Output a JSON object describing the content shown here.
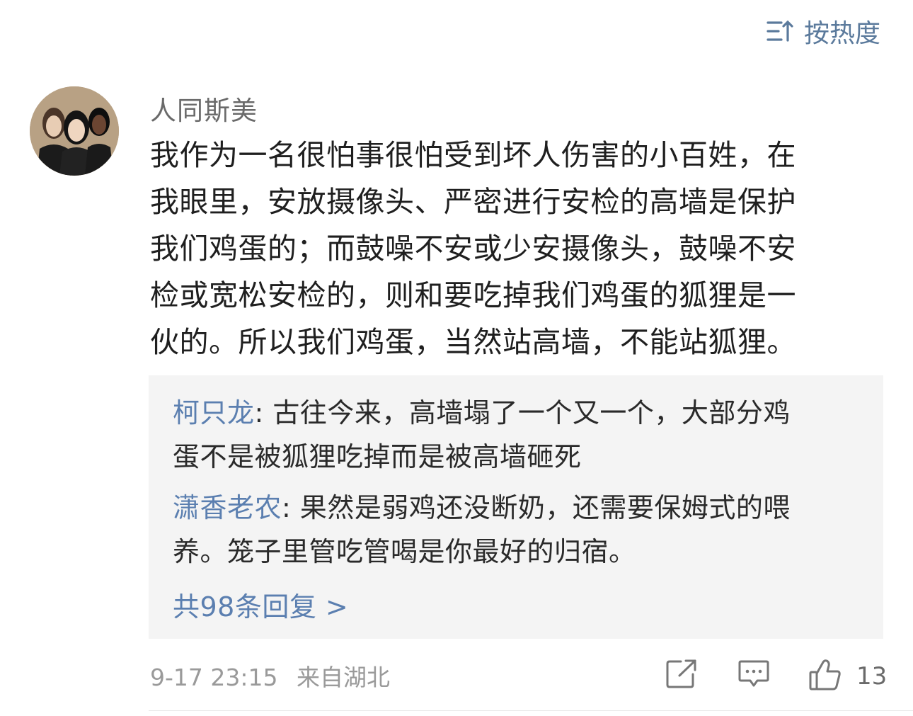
{
  "sort": {
    "icon": "sort-icon",
    "label": "按热度"
  },
  "comment": {
    "author": "人同斯美",
    "avatar_icon": "avatar-image",
    "lines": [
      "我作为一名很怕事很怕受到坏人伤害的小百姓，在",
      "我眼里，安放摄像头、严密进行安检的高墙是保护",
      "我们鸡蛋的；而鼓噪不安或少安摄像头，鼓噪不安",
      "检或宽松安检的，则和要吃掉我们鸡蛋的狐狸是一",
      "伙的。所以我们鸡蛋，当然站高墙，不能站狐狸。"
    ],
    "replies": [
      {
        "author": "柯只龙",
        "lines": [
          ": 古往今来，高墙塌了一个又一个，大部分鸡",
          "蛋不是被狐狸吃掉而是被高墙砸死"
        ]
      },
      {
        "author": "潇香老农",
        "lines": [
          ": 果然是弱鸡还没断奶，还需要保姆式的喂",
          "养。笼子里管吃管喝是你最好的归宿。"
        ]
      }
    ],
    "total_replies": "共98条回复 >",
    "date": "9-17 23:15",
    "location": "来自湖北",
    "actions": {
      "share_icon": "share-icon",
      "comment_icon": "comment-icon",
      "like_icon": "thumbs-up-icon",
      "like_count": "13"
    }
  },
  "colors": {
    "link": "#5b7fb0",
    "sort": "#5b7a9c",
    "reply_bg": "#f4f4f4",
    "meta": "#9a9a9a"
  }
}
